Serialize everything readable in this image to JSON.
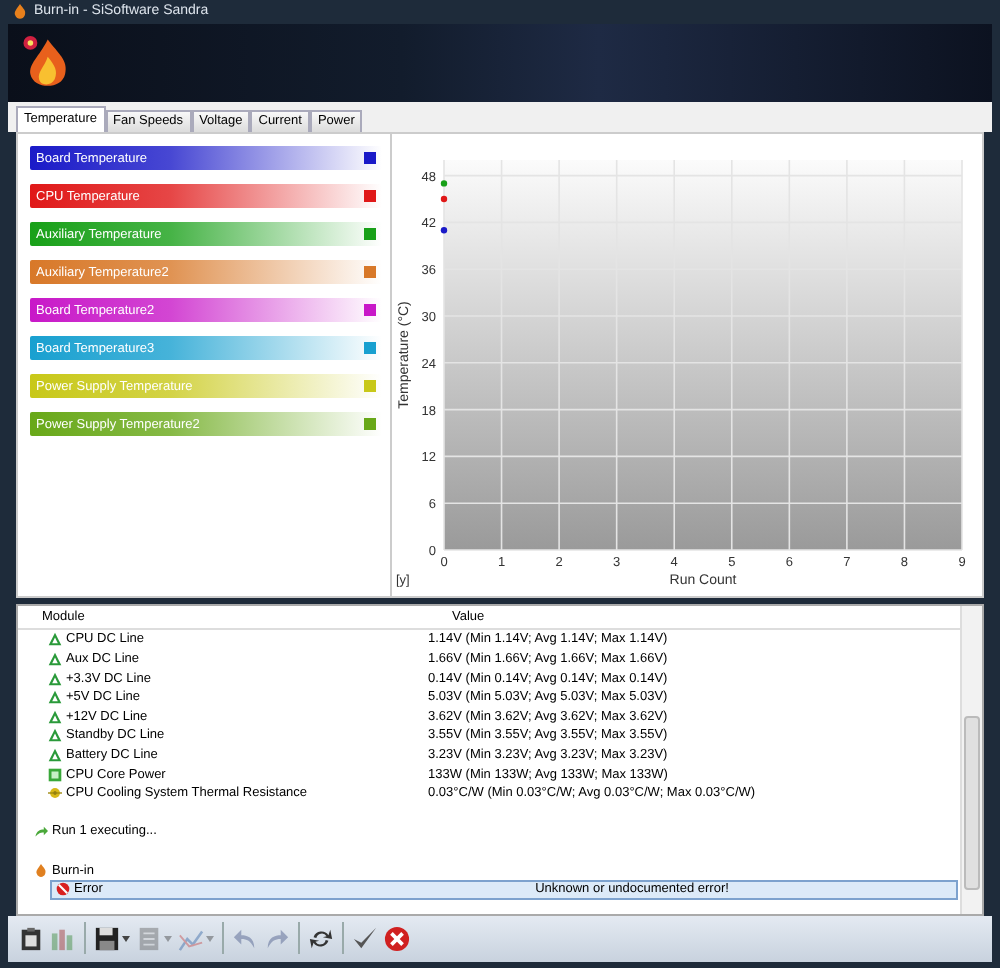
{
  "window": {
    "title": "Burn-in - SiSoftware Sandra"
  },
  "tabs": [
    {
      "label": "Temperature",
      "selected": true
    },
    {
      "label": "Fan Speeds",
      "selected": false
    },
    {
      "label": "Voltage",
      "selected": false
    },
    {
      "label": "Current",
      "selected": false
    },
    {
      "label": "Power",
      "selected": false
    }
  ],
  "chart_data": {
    "type": "scatter",
    "xlabel": "Run Count",
    "ylabel": "Temperature (°C)",
    "x": [
      0
    ],
    "series": [
      {
        "name": "Board Temperature",
        "color": "#1a1ac8",
        "values": [
          41
        ]
      },
      {
        "name": "CPU Temperature",
        "color": "#e01818",
        "values": [
          45
        ]
      },
      {
        "name": "Auxiliary Temperature",
        "color": "#18a018",
        "values": [
          47
        ]
      },
      {
        "name": "Auxiliary Temperature2",
        "color": "#d87828",
        "values": [
          null
        ]
      },
      {
        "name": "Board Temperature2",
        "color": "#c818c8",
        "values": [
          null
        ]
      },
      {
        "name": "Board Temperature3",
        "color": "#18a0d0",
        "values": [
          null
        ]
      },
      {
        "name": "Power Supply Temperature",
        "color": "#c8c818",
        "values": [
          null
        ]
      },
      {
        "name": "Power Supply Temperature2",
        "color": "#68a818",
        "values": [
          null
        ]
      }
    ],
    "grid": true,
    "xlim": [
      0,
      9
    ],
    "ylim": [
      0,
      50
    ],
    "xticks": [
      0,
      1,
      2,
      3,
      4,
      5,
      6,
      7,
      8,
      9
    ],
    "yticks": [
      0,
      6,
      12,
      18,
      24,
      30,
      36,
      42,
      48
    ]
  },
  "chart_corner": "[y]",
  "list": {
    "columns": [
      "Module",
      "Value"
    ],
    "rows": [
      {
        "kind": "voltage",
        "module": "CPU DC Line",
        "value": "1.14V (Min 1.14V; Avg 1.14V; Max 1.14V)"
      },
      {
        "kind": "voltage",
        "module": "Aux DC Line",
        "value": "1.66V (Min 1.66V; Avg 1.66V; Max 1.66V)"
      },
      {
        "kind": "voltage",
        "module": "+3.3V DC Line",
        "value": "0.14V (Min 0.14V; Avg 0.14V; Max 0.14V)"
      },
      {
        "kind": "voltage",
        "module": "+5V DC Line",
        "value": "5.03V (Min 5.03V; Avg 5.03V; Max 5.03V)"
      },
      {
        "kind": "voltage",
        "module": "+12V DC Line",
        "value": "3.62V (Min 3.62V; Avg 3.62V; Max 3.62V)"
      },
      {
        "kind": "voltage",
        "module": "Standby DC Line",
        "value": "3.55V (Min 3.55V; Avg 3.55V; Max 3.55V)"
      },
      {
        "kind": "voltage",
        "module": "Battery DC Line",
        "value": "3.23V (Min 3.23V; Avg 3.23V; Max 3.23V)"
      },
      {
        "kind": "power",
        "module": "CPU Core Power",
        "value": "133W (Min 133W; Avg 133W; Max 133W)"
      },
      {
        "kind": "thermal",
        "module": "CPU Cooling System Thermal Resistance",
        "value": "0.03°C/W (Min 0.03°C/W; Avg 0.03°C/W; Max 0.03°C/W)"
      },
      {
        "kind": "spacer"
      },
      {
        "kind": "run",
        "module": "Run 1 executing..."
      },
      {
        "kind": "spacer"
      },
      {
        "kind": "group",
        "module": "Burn-in"
      },
      {
        "kind": "error",
        "module": "Error",
        "value": "Unknown or undocumented error!",
        "selected": true
      }
    ]
  },
  "toolbar": [
    {
      "kind": "clipboard",
      "disabled": false,
      "dropdown": false
    },
    {
      "kind": "bars",
      "disabled": true,
      "dropdown": false
    },
    {
      "kind": "save",
      "disabled": false,
      "dropdown": true
    },
    {
      "kind": "document",
      "disabled": true,
      "dropdown": true
    },
    {
      "kind": "chart",
      "disabled": true,
      "dropdown": true
    },
    {
      "kind": "undo",
      "disabled": true,
      "dropdown": false
    },
    {
      "kind": "redo",
      "disabled": true,
      "dropdown": false
    },
    {
      "kind": "refresh",
      "disabled": false,
      "dropdown": false
    },
    {
      "kind": "check",
      "disabled": false,
      "dropdown": false
    },
    {
      "kind": "stop",
      "disabled": false,
      "dropdown": false
    }
  ]
}
